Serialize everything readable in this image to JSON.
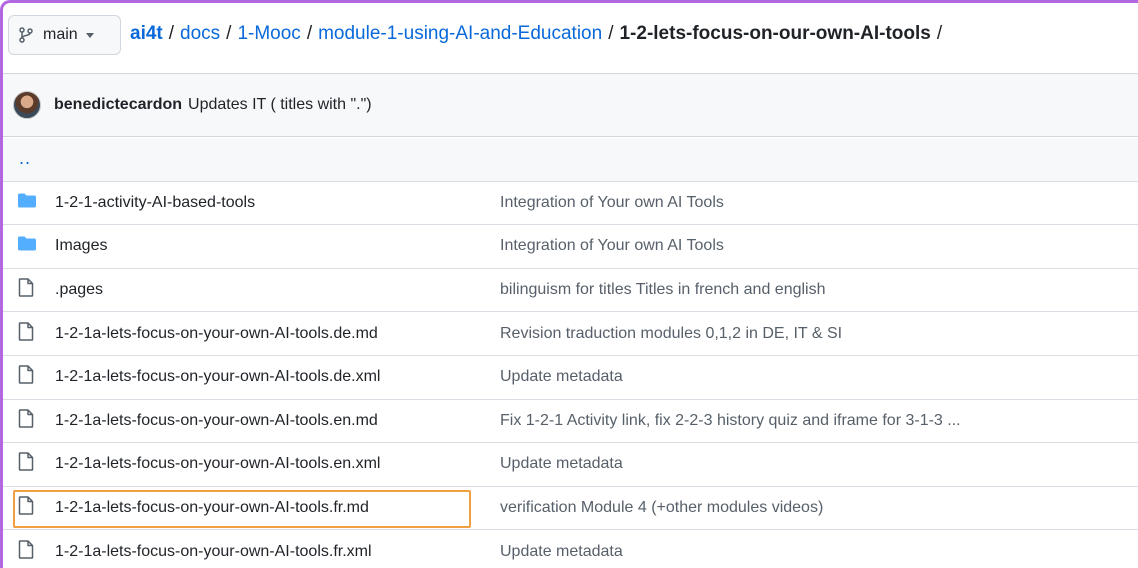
{
  "branch": {
    "label": "main",
    "icon": "git-branch-icon"
  },
  "breadcrumb": {
    "repo": "ai4t",
    "parts": [
      "docs",
      "1-Mooc",
      "module-1-using-AI-and-Education"
    ],
    "current": "1-2-lets-focus-on-our-own-AI-tools",
    "separator": "/"
  },
  "commit": {
    "author": "benedictecardon",
    "message": "Updates IT ( titles with \".\")"
  },
  "parent_link": "..",
  "files": [
    {
      "type": "folder",
      "name": "1-2-1-activity-AI-based-tools",
      "message": "Integration of Your own AI Tools"
    },
    {
      "type": "folder",
      "name": "Images",
      "message": "Integration of Your own AI Tools"
    },
    {
      "type": "file",
      "name": ".pages",
      "message": "bilinguism for titles Titles in french and english"
    },
    {
      "type": "file",
      "name": "1-2-1a-lets-focus-on-your-own-AI-tools.de.md",
      "message": "Revision traduction modules 0,1,2 in DE, IT & SI"
    },
    {
      "type": "file",
      "name": "1-2-1a-lets-focus-on-your-own-AI-tools.de.xml",
      "message": "Update metadata"
    },
    {
      "type": "file",
      "name": "1-2-1a-lets-focus-on-your-own-AI-tools.en.md",
      "message": "Fix 1-2-1 Activity link, fix 2-2-3 history quiz and iframe for 3-1-3 ..."
    },
    {
      "type": "file",
      "name": "1-2-1a-lets-focus-on-your-own-AI-tools.en.xml",
      "message": "Update metadata"
    },
    {
      "type": "file",
      "name": "1-2-1a-lets-focus-on-your-own-AI-tools.fr.md",
      "message": "verification Module 4 (+other modules videos)",
      "highlighted": true
    },
    {
      "type": "file",
      "name": "1-2-1a-lets-focus-on-your-own-AI-tools.fr.xml",
      "message": "Update metadata"
    }
  ],
  "colors": {
    "link": "#0969da",
    "folder": "#54aeff",
    "highlight": "#f0a040",
    "frame": "#b266e0"
  }
}
